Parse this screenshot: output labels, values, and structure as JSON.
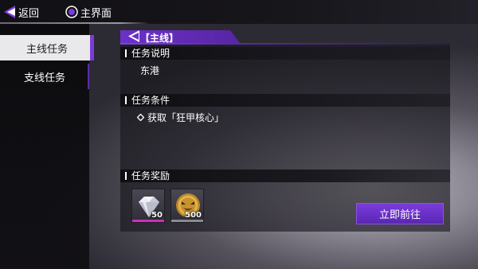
{
  "topbar": {
    "back_label": "返回",
    "home_label": "主界面",
    "back_icon": "back-arrow-icon",
    "home_icon": "home-circle-icon"
  },
  "sidebar": {
    "tabs": [
      {
        "label": "主线任务",
        "active": true
      },
      {
        "label": "支线任务",
        "active": false
      }
    ]
  },
  "panel": {
    "title": "【主线】",
    "sections": {
      "description": {
        "header": "任务说明",
        "text": "东港"
      },
      "conditions": {
        "header": "任务条件",
        "items": [
          "获取「狂甲核心」"
        ]
      },
      "rewards": {
        "header": "任务奖励",
        "items": [
          {
            "icon": "diamond-icon",
            "quantity": "50",
            "rarity_color": "#cc2fb8"
          },
          {
            "icon": "gold-coin-icon",
            "quantity": "500",
            "rarity_color": "#8a8893"
          }
        ]
      }
    },
    "go_button": "立即前往"
  },
  "colors": {
    "accent_purple": "#6c31c9",
    "button_purple": "#7a3cdc",
    "active_tab_bg": "#e9e9ec"
  }
}
